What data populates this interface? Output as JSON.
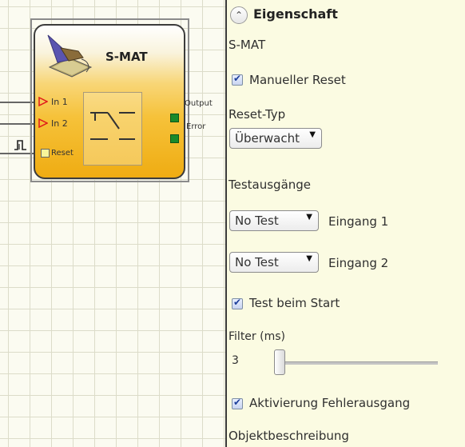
{
  "block": {
    "title": "S-MAT",
    "inputs": [
      "In 1",
      "In 2",
      "Reset"
    ],
    "outputs": [
      "Output",
      "Error"
    ]
  },
  "panel": {
    "header": "Eigenschaft",
    "object_name": "S-MAT",
    "manual_reset": {
      "label": "Manueller Reset",
      "checked": true
    },
    "reset_type": {
      "label": "Reset-Typ",
      "value": "Überwacht"
    },
    "test_outputs_label": "Testausgänge",
    "input1": {
      "value": "No Test",
      "label": "Eingang 1"
    },
    "input2": {
      "value": "No Test",
      "label": "Eingang 2"
    },
    "test_at_start": {
      "label": "Test beim Start",
      "checked": true
    },
    "filter": {
      "label": "Filter (ms)",
      "value": "3"
    },
    "enable_error_output": {
      "label": "Aktivierung Fehlerausgang",
      "checked": true
    },
    "object_description_label": "Objektbeschreibung"
  },
  "icons": {
    "collapse": "chevron-up-icon",
    "dropdown_arrow": "triangle-down-icon",
    "pulse": "pulse-signal-icon",
    "contact": "switch-contact-icon"
  },
  "colors": {
    "block_fill": "#f6c23a",
    "panel_bg": "#fbfbe2",
    "output_pin": "#1a8a2a"
  }
}
